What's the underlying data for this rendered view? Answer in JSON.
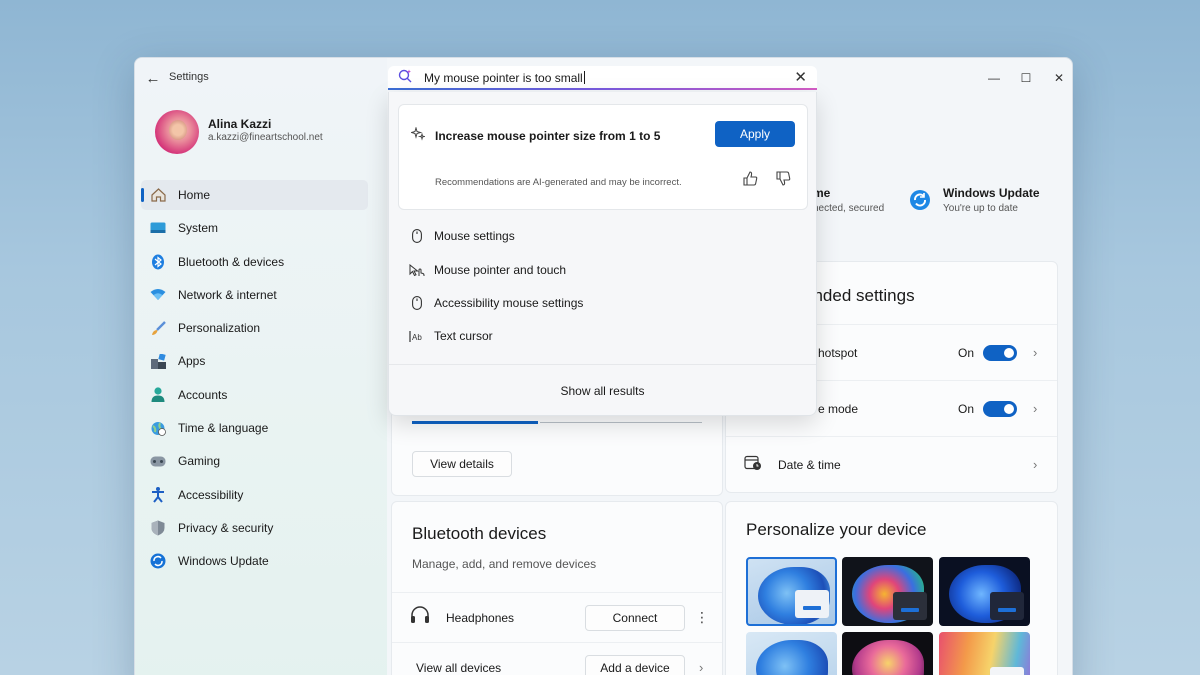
{
  "window": {
    "title": "Settings",
    "back_icon": "back-arrow-icon",
    "controls": [
      "minimize-icon",
      "maximize-icon",
      "close-icon"
    ]
  },
  "profile": {
    "name": "Alina Kazzi",
    "email": "a.kazzi@fineartschool.net"
  },
  "sidebar": {
    "items": [
      {
        "label": "Home",
        "icon": "home-icon",
        "active": true
      },
      {
        "label": "System",
        "icon": "system-icon"
      },
      {
        "label": "Bluetooth & devices",
        "icon": "bluetooth-icon"
      },
      {
        "label": "Network & internet",
        "icon": "wifi-icon"
      },
      {
        "label": "Personalization",
        "icon": "brush-icon"
      },
      {
        "label": "Apps",
        "icon": "apps-icon"
      },
      {
        "label": "Accounts",
        "icon": "accounts-icon"
      },
      {
        "label": "Time & language",
        "icon": "globe-clock-icon"
      },
      {
        "label": "Gaming",
        "icon": "gamepad-icon"
      },
      {
        "label": "Accessibility",
        "icon": "accessibility-icon"
      },
      {
        "label": "Privacy & security",
        "icon": "shield-icon"
      },
      {
        "label": "Windows Update",
        "icon": "update-icon"
      }
    ]
  },
  "search": {
    "value": "My mouse pointer is too small",
    "ai_suggestion": "Increase mouse pointer size from 1 to 5",
    "apply_label": "Apply",
    "disclaimer": "Recommendations are AI-generated and may be incorrect.",
    "results": [
      {
        "label": "Mouse settings",
        "icon": "mouse-icon"
      },
      {
        "label": "Mouse pointer and touch",
        "icon": "pointer-touch-icon"
      },
      {
        "label": "Accessibility mouse settings",
        "icon": "mouse-icon"
      },
      {
        "label": "Text cursor",
        "icon": "text-cursor-icon"
      }
    ],
    "show_all_label": "Show all results"
  },
  "main": {
    "status_network_title": "me",
    "status_network_sub": "nected, secured",
    "status_update_title": "Windows Update",
    "status_update_sub": "You're up to date",
    "recommended_title": "ended settings",
    "hotspot_label": "hotspot",
    "hotspot_state": "On",
    "mode_label": "e mode",
    "mode_state": "On",
    "datetime_label": "Date & time",
    "view_details_label": "View details",
    "bluetooth_title": "Bluetooth devices",
    "bluetooth_sub": "Manage, add, and remove devices",
    "headphones_label": "Headphones",
    "connect_label": "Connect",
    "view_all_label": "View all devices",
    "add_device_label": "Add a device",
    "personalize_title": "Personalize your device"
  },
  "colors": {
    "accent": "#0f62c4"
  }
}
